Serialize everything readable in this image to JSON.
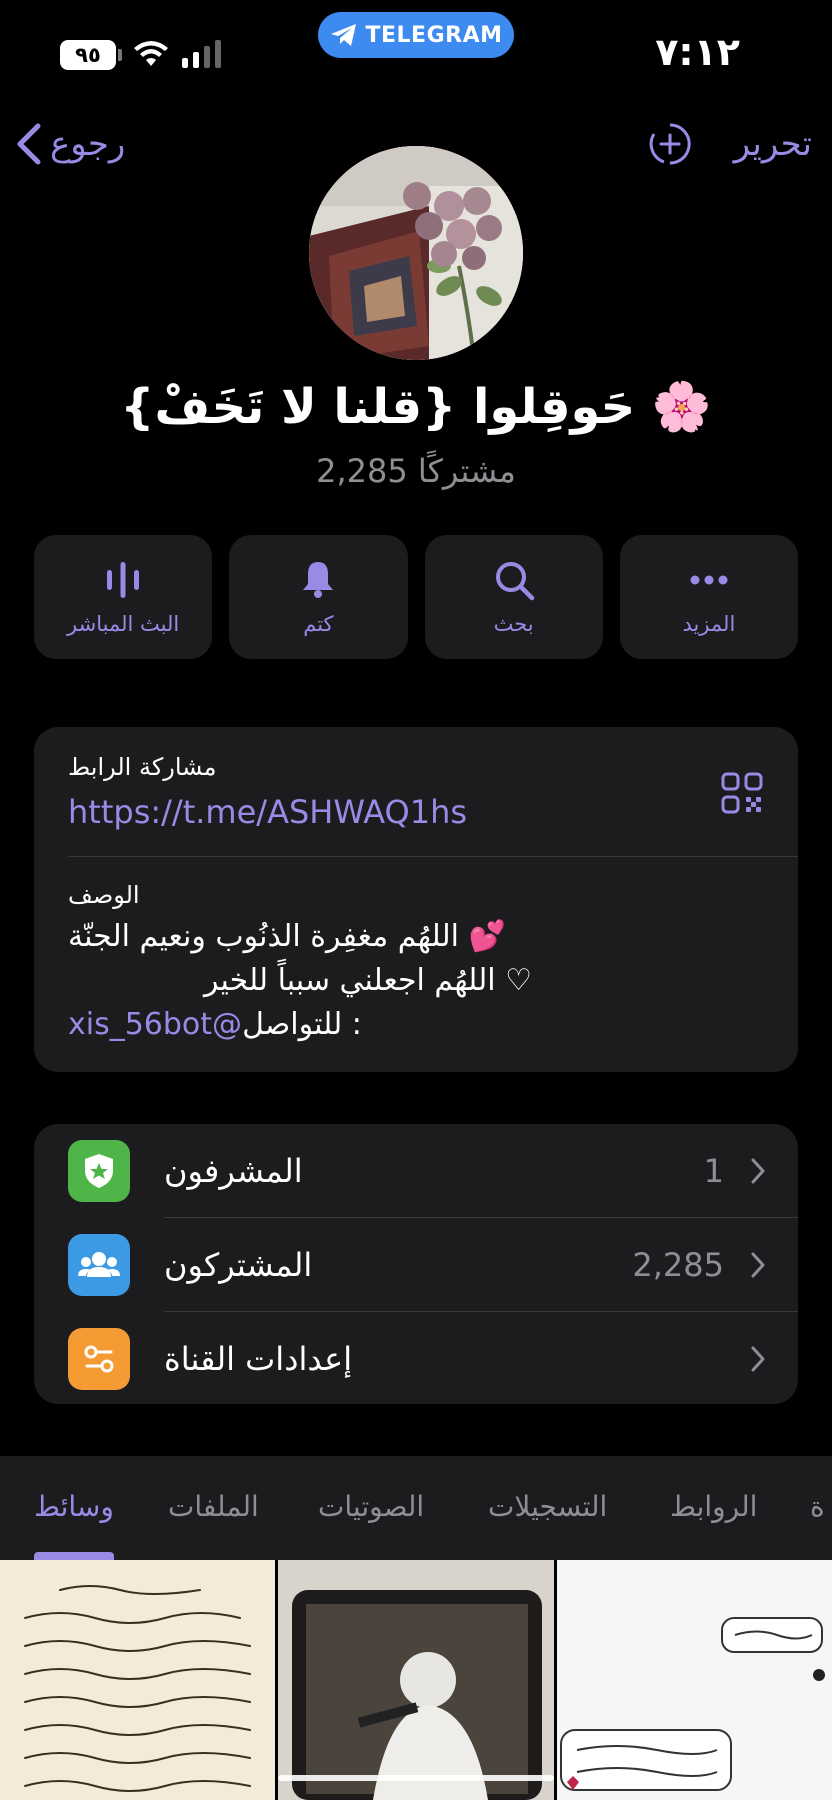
{
  "status_bar": {
    "battery": "٩٥",
    "app_pill": "TELEGRAM",
    "time": "٧:١٢"
  },
  "nav": {
    "back_label": "رجوع",
    "edit_label": "تحرير"
  },
  "channel": {
    "title": "{قلنا لا تَخَفْ} حَوقِلوا 🌸",
    "subscribers": "2,285 مشتركًا"
  },
  "actions": [
    {
      "label": "البث المباشر",
      "icon": "live-stream-icon"
    },
    {
      "label": "كتم",
      "icon": "bell-icon"
    },
    {
      "label": "بحث",
      "icon": "search-icon"
    },
    {
      "label": "المزيد",
      "icon": "more-icon"
    }
  ],
  "info": {
    "share_label": "مشاركة الرابط",
    "link": "https://t.me/ASHWAQ1hs",
    "description_label": "الوصف",
    "description_line1": "اللهُم مغفِرة الذنُوب ونعيم الجنّة 💕",
    "description_line2": "اللهُم اجعلني سبباً للخير ♡",
    "contact_prefix": "للتواصل : ",
    "contact_handle": "xis_56bot@"
  },
  "settings": [
    {
      "label": "المشرفون",
      "value": "1",
      "icon": "admin-shield-icon",
      "color": "#4fb548"
    },
    {
      "label": "المشتركون",
      "value": "2,285",
      "icon": "subscribers-icon",
      "color": "#3b9ae3"
    },
    {
      "label": "إعدادات القناة",
      "value": "",
      "icon": "settings-toggle-icon",
      "color": "#f49b33"
    }
  ],
  "tabs": [
    "وسائط",
    "الملفات",
    "الصوتيات",
    "التسجيلات",
    "الروابط",
    "ة"
  ],
  "colors": {
    "accent": "#9b89e6",
    "card_bg": "#1c1c1e",
    "background": "#000000"
  }
}
